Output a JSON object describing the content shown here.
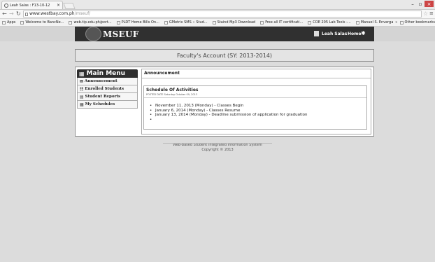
{
  "browser": {
    "tab_title": "Leah Salas : F13-10-12",
    "url_domain": "www.westbay.com.ph",
    "url_path": "/mseuf/",
    "bookmarks": [
      "Apps",
      "Welcome to BancNe...",
      "web.tip.edu.ph/port...",
      "PLDT Home Bills On...",
      "GMetrix SMS :: Stud...",
      "Staind Mp3 Download",
      "Free all IT certificati...",
      "COE 205 Lab Tools -...",
      "Manuel S. Enverga U...",
      "»",
      "Other bookmarks"
    ]
  },
  "header": {
    "logo_text": "MSEUF",
    "user_name": "Leah Salas",
    "home_label": "Home"
  },
  "account_banner": "Faculty's Account (SY: 2013-2014)",
  "main_menu": {
    "title": "Main Menu",
    "items": [
      "Announcement",
      "Enrolled Students",
      "Student Reports",
      "My Schedules"
    ]
  },
  "announcement": {
    "heading": "Announcement",
    "schedule_title": "Schedule Of Activities",
    "posted_date": "POSTED DATE Saturday October 09, 2013",
    "items": [
      "November 11, 2013 (Monday) - Classes Begin",
      "January 6, 2014 (Monday) - Classes Resume",
      "January 13, 2014 (Monday) - Deadline submission of application for graduation",
      ""
    ]
  },
  "footer": {
    "line1": "Web-based Student Integrated Information System",
    "line2": "Copyright © 2013"
  }
}
